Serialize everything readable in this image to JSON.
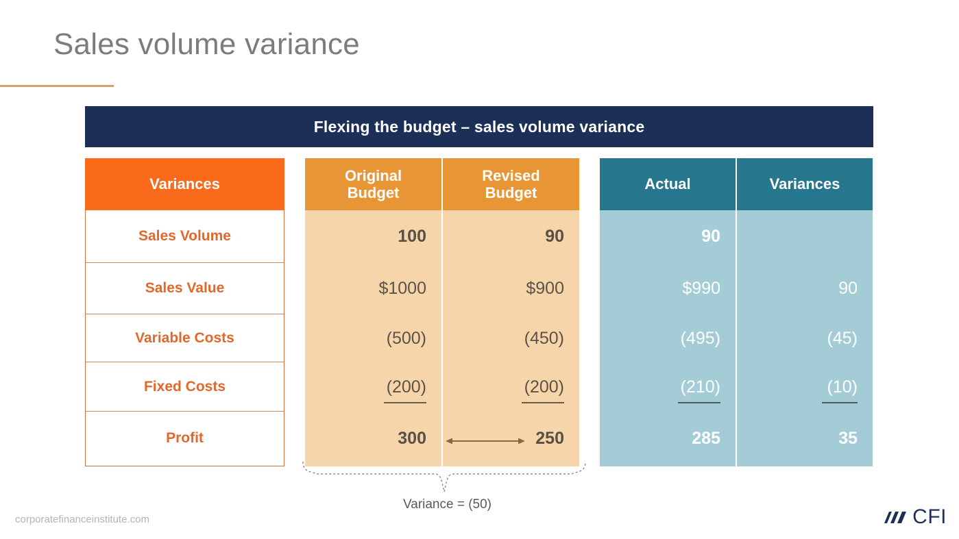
{
  "slide": {
    "title": "Sales volume variance",
    "banner": "Flexing the budget – sales volume variance"
  },
  "colors": {
    "accent_orange": "#F96A1B",
    "header_orange": "#E89635",
    "body_peach": "#F6D5AB",
    "header_teal": "#26778E",
    "body_teal": "#A3CCD6",
    "banner_navy": "#1C3057",
    "title_gray": "#7C7C7C"
  },
  "table": {
    "left_header": "Variances",
    "row_labels": [
      "Sales Volume",
      "Sales Value",
      "Variable Costs",
      "Fixed Costs",
      "Profit"
    ],
    "columns": [
      {
        "header_line1": "Original",
        "header_line2": "Budget",
        "group": "budget",
        "values": [
          "100",
          "$1000",
          "(500)",
          "(200)",
          "300"
        ],
        "bold": [
          true,
          false,
          false,
          false,
          true
        ],
        "underline": [
          false,
          false,
          false,
          true,
          false
        ]
      },
      {
        "header_line1": "Revised",
        "header_line2": "Budget",
        "group": "budget",
        "values": [
          "90",
          "$900",
          "(450)",
          "(200)",
          "250"
        ],
        "bold": [
          true,
          false,
          false,
          false,
          true
        ],
        "underline": [
          false,
          false,
          false,
          true,
          false
        ]
      },
      {
        "header_line1": "Actual",
        "header_line2": "",
        "group": "actual",
        "values": [
          "90",
          "$990",
          "(495)",
          "(210)",
          "285"
        ],
        "bold": [
          true,
          false,
          false,
          false,
          true
        ],
        "underline": [
          false,
          false,
          false,
          true,
          false
        ]
      },
      {
        "header_line1": "Variances",
        "header_line2": "",
        "group": "actual",
        "values": [
          "",
          "90",
          "(45)",
          "(10)",
          "35"
        ],
        "bold": [
          false,
          false,
          false,
          false,
          true
        ],
        "underline": [
          false,
          false,
          false,
          true,
          false
        ]
      }
    ]
  },
  "annotation": {
    "brace_label": "Variance = (50)",
    "arrow": "double-headed-arrow"
  },
  "footer": {
    "url": "corporatefinanceinstitute.com",
    "logo_text": "CFI"
  }
}
